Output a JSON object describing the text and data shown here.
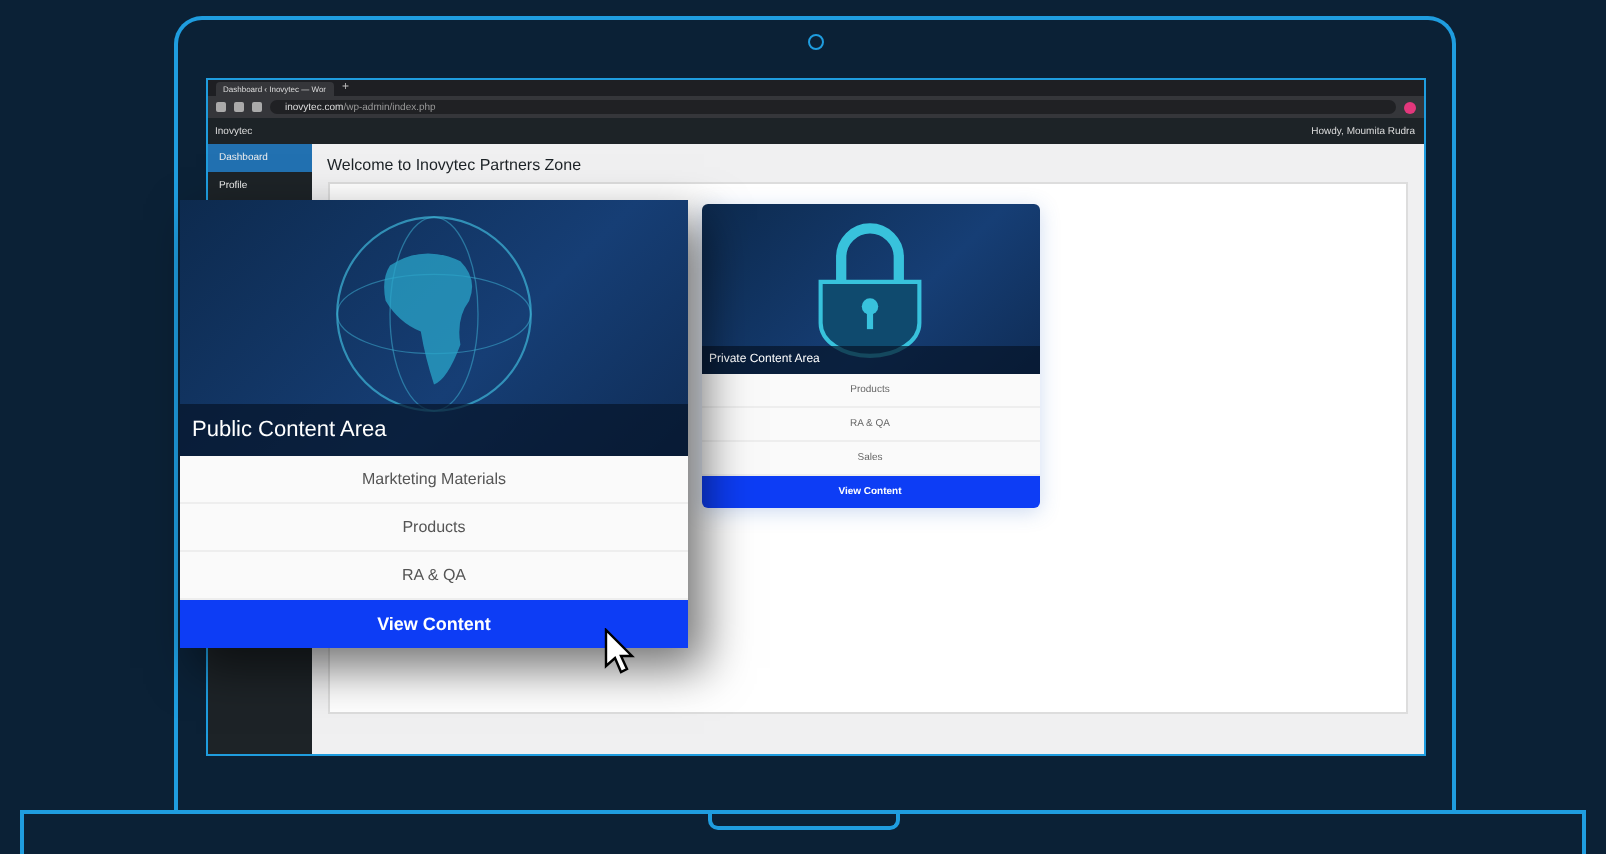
{
  "browser": {
    "tab_title": "Dashboard ‹ Inovytec — Wor",
    "new_tab": "+",
    "url_domain": "inovytec.com",
    "url_path": "/wp-admin/index.php"
  },
  "admin_bar": {
    "site": "Inovytec",
    "greeting": "Howdy, Moumita Rudra"
  },
  "sidebar": {
    "items": [
      {
        "label": "Dashboard",
        "selected": true
      },
      {
        "label": "Profile",
        "selected": false
      }
    ]
  },
  "page": {
    "heading": "Welcome to Inovytec Partners Zone"
  },
  "private_card": {
    "title": "Private Content Area",
    "items": [
      "Products",
      "RA & QA",
      "Sales"
    ],
    "button": "View Content"
  },
  "public_card": {
    "title": "Public Content Area",
    "items": [
      "Markteting Materials",
      "Products",
      "RA & QA"
    ],
    "button": "View Content"
  }
}
